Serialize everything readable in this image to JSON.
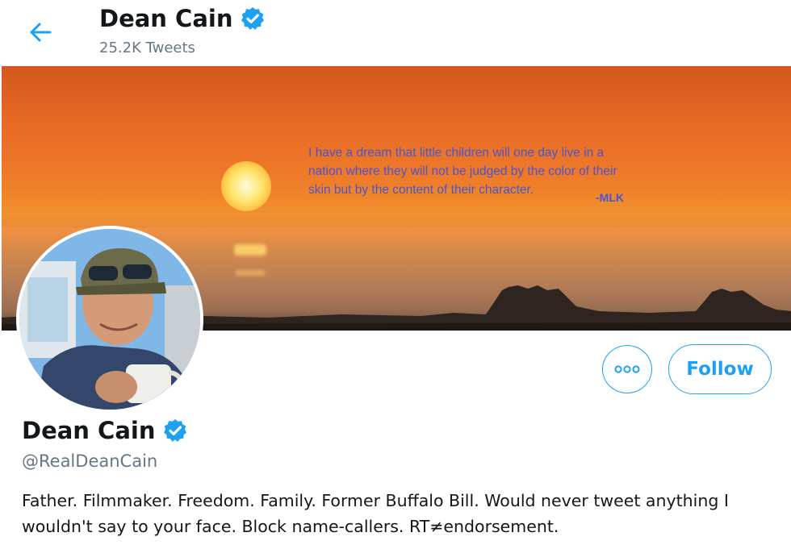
{
  "header": {
    "back_icon": "arrow-left-icon",
    "title": "Dean Cain",
    "tweets_count": "25.2K Tweets",
    "verified_icon": "verified-badge-icon"
  },
  "banner": {
    "quote_line1": "I have a dream that little children will one day live in a",
    "quote_line2": "nation where they will not be judged by the color of their",
    "quote_line3": "skin but by the content of their character.",
    "quote_attribution": "-MLK"
  },
  "actions": {
    "more_icon": "more-options-icon",
    "follow_label": "Follow"
  },
  "profile": {
    "name": "Dean Cain",
    "handle": "@RealDeanCain",
    "bio": "Father. Filmmaker. Freedom. Family. Former Buffalo Bill. Would never tweet anything I wouldn't say to your face. Block name-callers. RT≠endorsement."
  },
  "colors": {
    "accent": "#1da1f2",
    "text_primary": "#14171a",
    "text_secondary": "#657786"
  }
}
